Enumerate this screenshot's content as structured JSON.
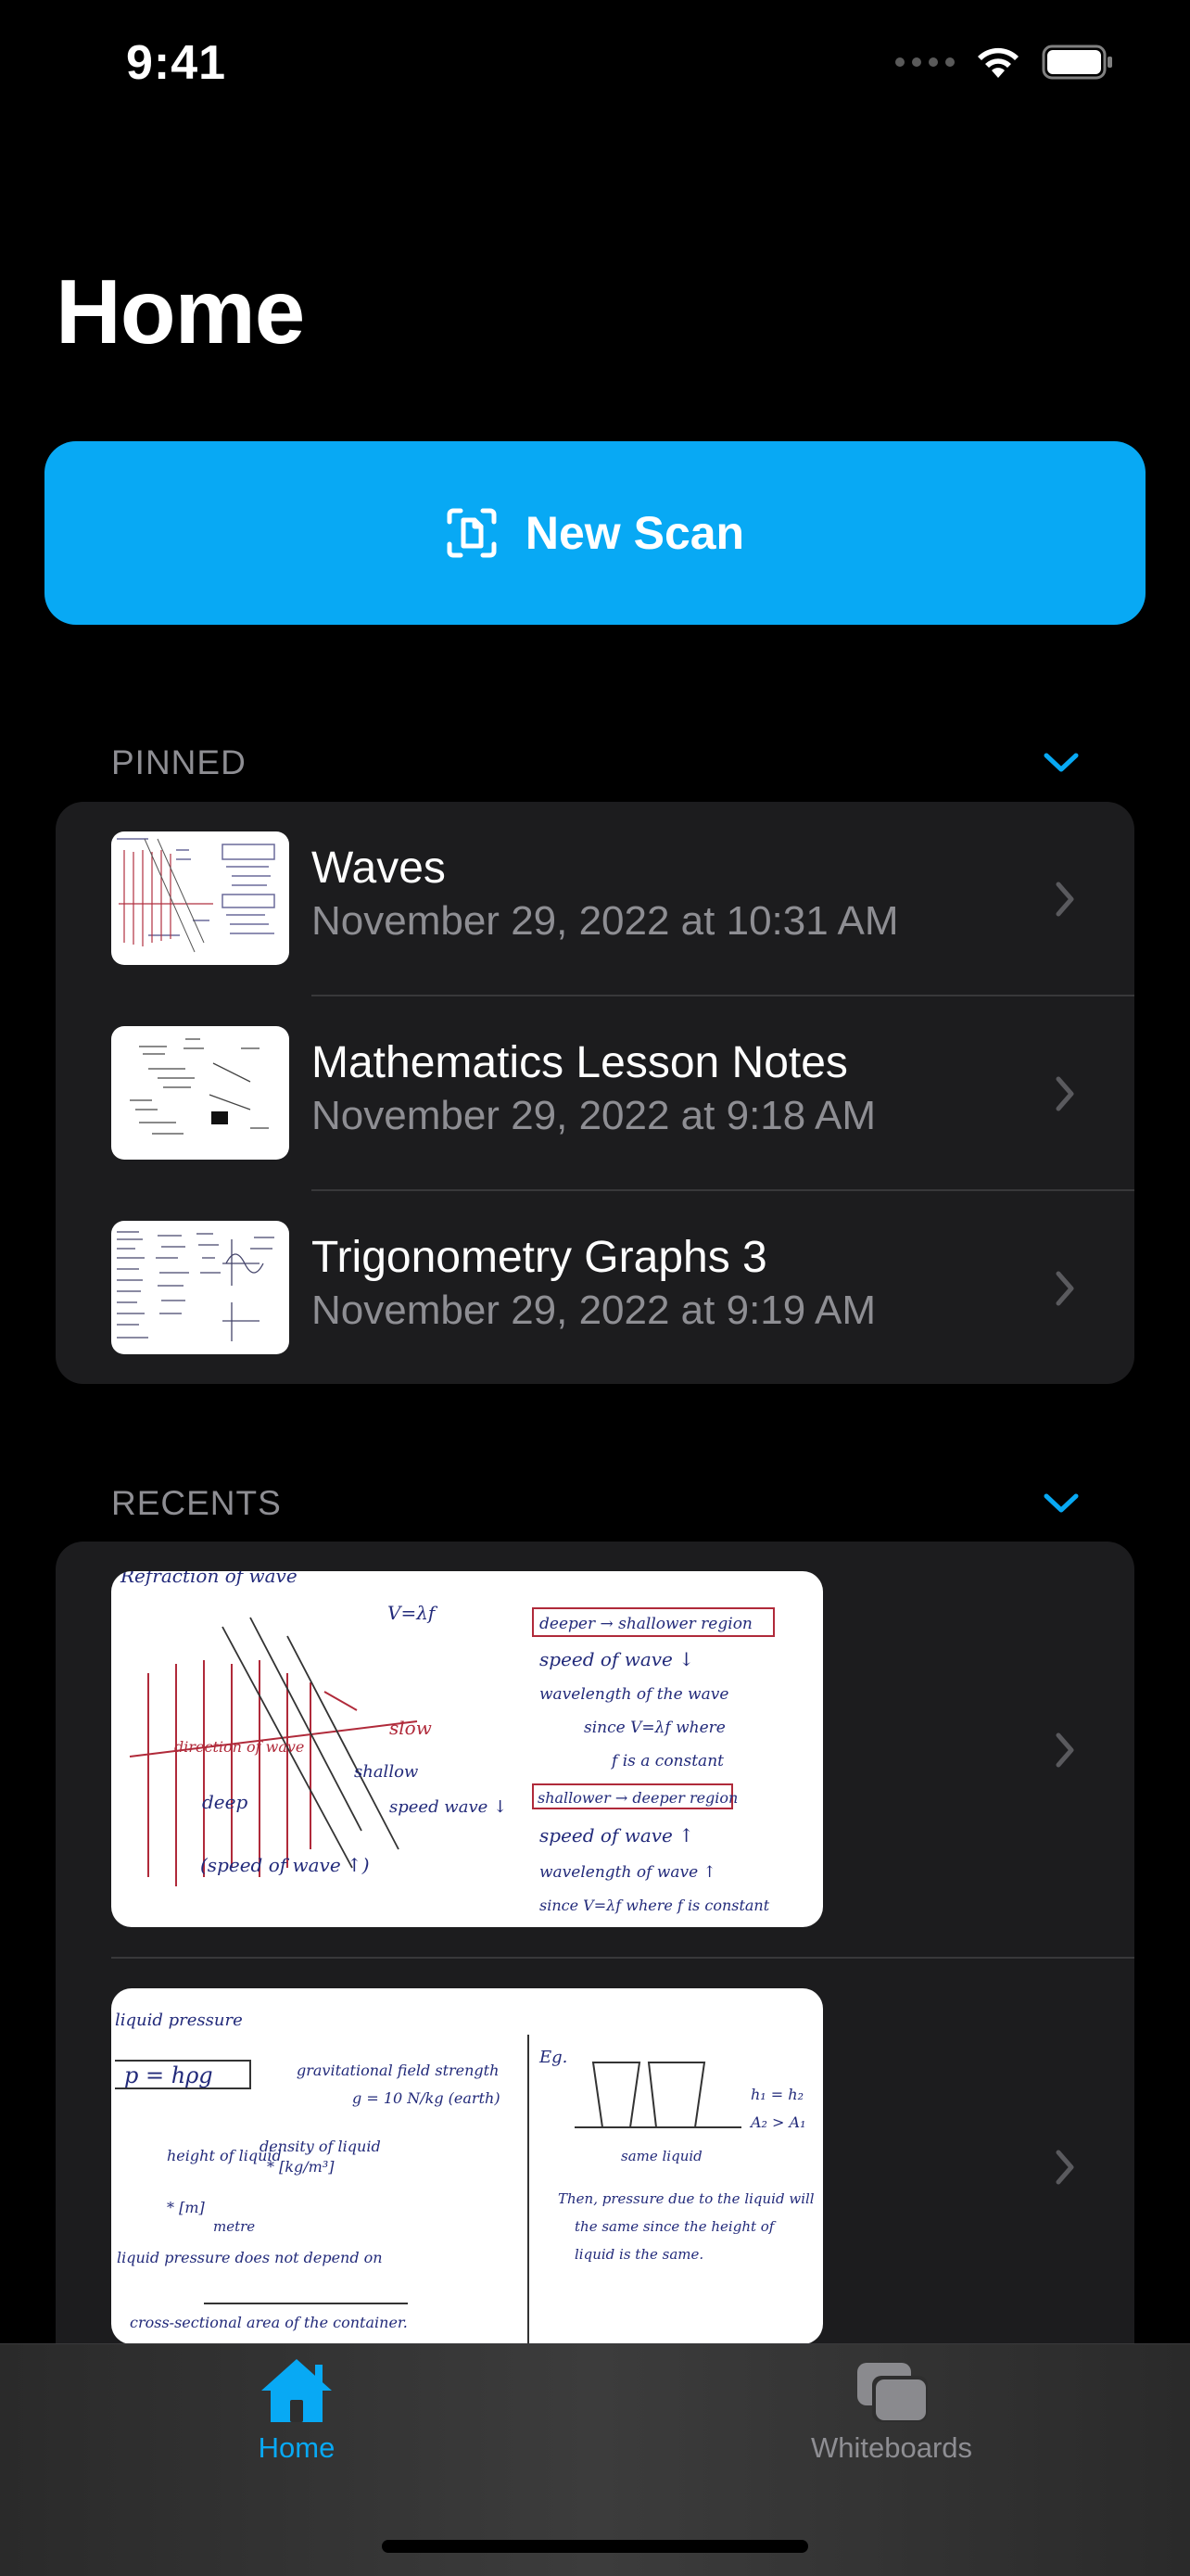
{
  "status_bar": {
    "time": "9:41"
  },
  "page": {
    "title": "Home"
  },
  "new_scan": {
    "label": "New Scan"
  },
  "colors": {
    "accent": "#08a9f4",
    "card": "#1c1c1e",
    "secondary_text": "#8e8e93"
  },
  "pinned": {
    "header": "PINNED",
    "items": [
      {
        "title": "Waves",
        "date": "November 29, 2022 at 10:31 AM"
      },
      {
        "title": "Mathematics Lesson Notes",
        "date": "November 29, 2022 at 9:18 AM"
      },
      {
        "title": "Trigonometry Graphs 3",
        "date": "November 29, 2022 at 9:19 AM"
      }
    ]
  },
  "recents": {
    "header": "RECENTS",
    "items": [
      {
        "thumbnail_text": [
          "Refraction of wave",
          "V=λf",
          "deeper → shallower region",
          "speed of wave ↓",
          "wavelength of the wave",
          "since V=λf where",
          "f is a constant",
          "direction of wave",
          "slow",
          "shallow",
          "deep",
          "speed wave ↓",
          "shallower → deeper region",
          "speed of wave ↑",
          "wavelength of wave ↑",
          "since V=λf where f is constant",
          "(speed of wave ↑)"
        ]
      },
      {
        "thumbnail_text": [
          "liquid pressure",
          "p = hρg",
          "gravitational field strength",
          "g = 10 N/kg (earth)",
          "density of liquid",
          "* [kg/m³]",
          "height of liquid",
          "* [m]",
          "metre",
          "liquid pressure does not depend on",
          "cross-sectional area of the container.",
          "Eg.",
          "h₁ = h₂",
          "A₂ > A₁",
          "same liquid",
          "Then, pressure due to the liquid will",
          "the same since the height of",
          "liquid is the same."
        ]
      }
    ]
  },
  "tabs": [
    {
      "label": "Home",
      "icon": "house-icon",
      "active": true
    },
    {
      "label": "Whiteboards",
      "icon": "stacked-whiteboards-icon",
      "active": false
    }
  ]
}
